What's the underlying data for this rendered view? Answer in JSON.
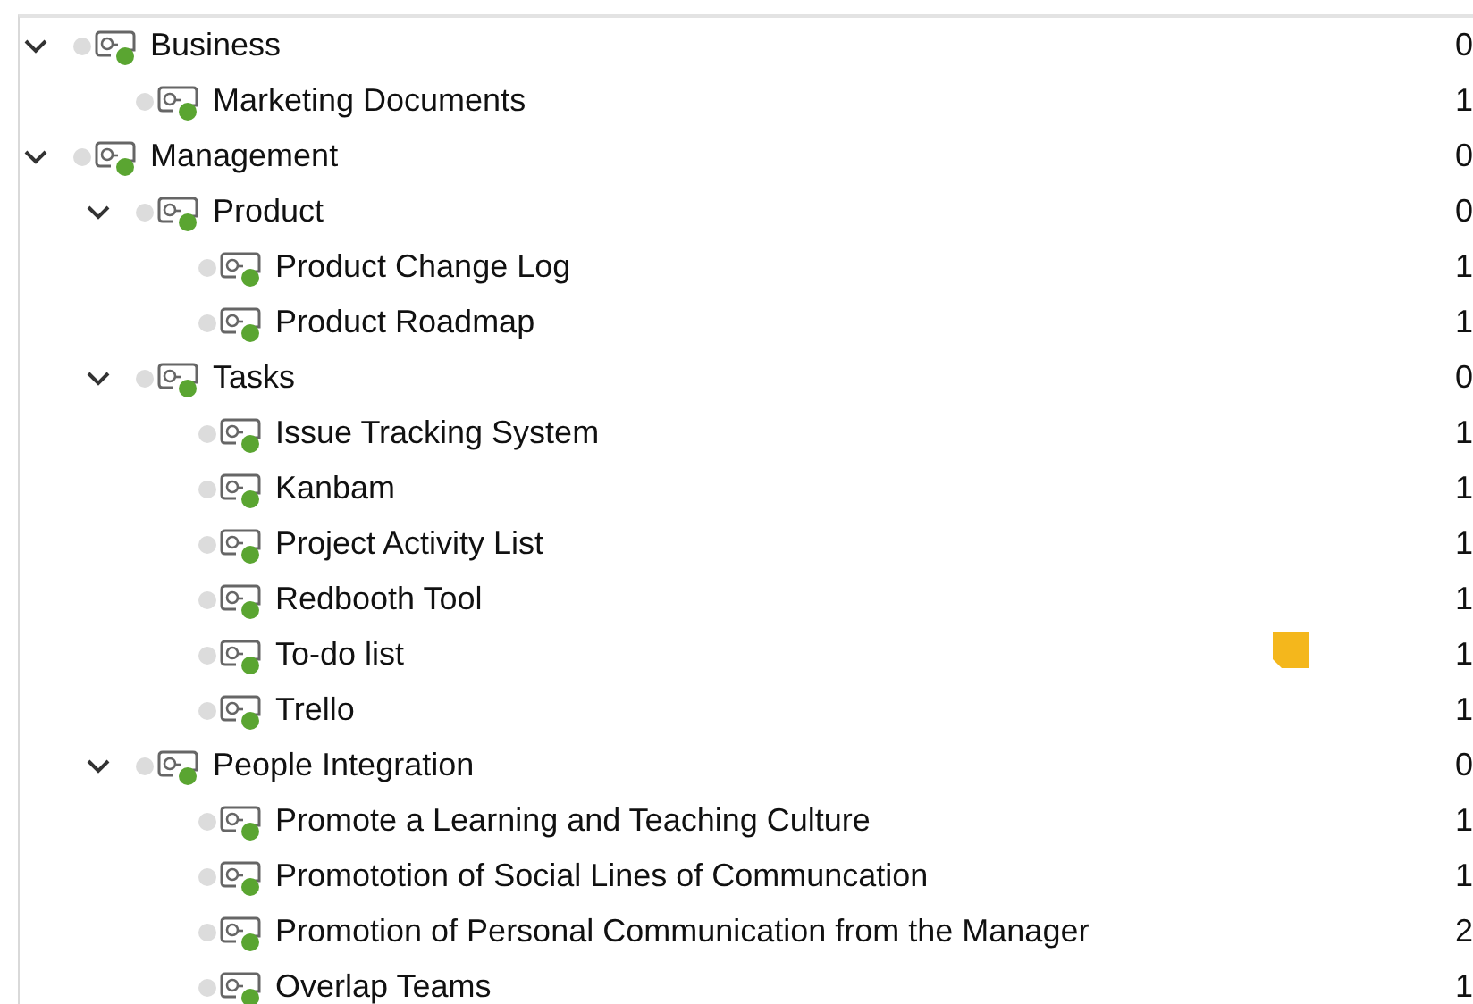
{
  "tree": [
    {
      "label": "Business",
      "count": "0",
      "expanded": true,
      "children": [
        {
          "label": "Marketing Documents",
          "count": "1"
        }
      ]
    },
    {
      "label": "Management",
      "count": "0",
      "expanded": true,
      "children": [
        {
          "label": "Product",
          "count": "0",
          "expanded": true,
          "children": [
            {
              "label": "Product Change Log",
              "count": "1"
            },
            {
              "label": "Product Roadmap",
              "count": "1"
            }
          ]
        },
        {
          "label": "Tasks",
          "count": "0",
          "expanded": true,
          "children": [
            {
              "label": "Issue Tracking System",
              "count": "1"
            },
            {
              "label": "Kanbam",
              "count": "1"
            },
            {
              "label": "Project Activity List",
              "count": "1"
            },
            {
              "label": "Redbooth Tool",
              "count": "1"
            },
            {
              "label": "To-do list",
              "count": "1",
              "note": true
            },
            {
              "label": "Trello",
              "count": "1"
            }
          ]
        },
        {
          "label": "People Integration",
          "count": "0",
          "expanded": true,
          "children": [
            {
              "label": "Promote a Learning and Teaching Culture",
              "count": "1"
            },
            {
              "label": "Promototion of Social Lines of Communcation",
              "count": "1"
            },
            {
              "label": "Promotion of Personal Communication from the Manager",
              "count": "2"
            },
            {
              "label": "Overlap Teams",
              "count": "1"
            }
          ]
        }
      ]
    }
  ]
}
